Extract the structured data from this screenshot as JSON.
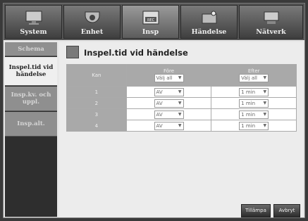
{
  "tabs": [
    {
      "label": "System",
      "icon": "monitor-icon"
    },
    {
      "label": "Enhet",
      "icon": "camera-icon"
    },
    {
      "label": "Insp",
      "icon": "rec-icon"
    },
    {
      "label": "Händelse",
      "icon": "event-icon"
    },
    {
      "label": "Nätverk",
      "icon": "network-icon"
    }
  ],
  "sidebar": [
    {
      "label": "Schema"
    },
    {
      "label": "Inspel.tid vid händelse"
    },
    {
      "label": "Insp.kv. och uppl."
    },
    {
      "label": "Insp.alt."
    }
  ],
  "page_title": "Inspel.tid vid händelse",
  "table": {
    "col_kan": "Kan",
    "col_before": "Före",
    "col_after": "Efter",
    "select_all_before": "Välj all",
    "select_all_after": "Välj all",
    "rows": [
      {
        "ch": "1",
        "before": "AV",
        "after": "1 min"
      },
      {
        "ch": "2",
        "before": "AV",
        "after": "1 min"
      },
      {
        "ch": "3",
        "before": "AV",
        "after": "1 min"
      },
      {
        "ch": "4",
        "before": "AV",
        "after": "1 min"
      }
    ]
  },
  "buttons": {
    "apply": "Tillämpa",
    "cancel": "Avbryt"
  }
}
